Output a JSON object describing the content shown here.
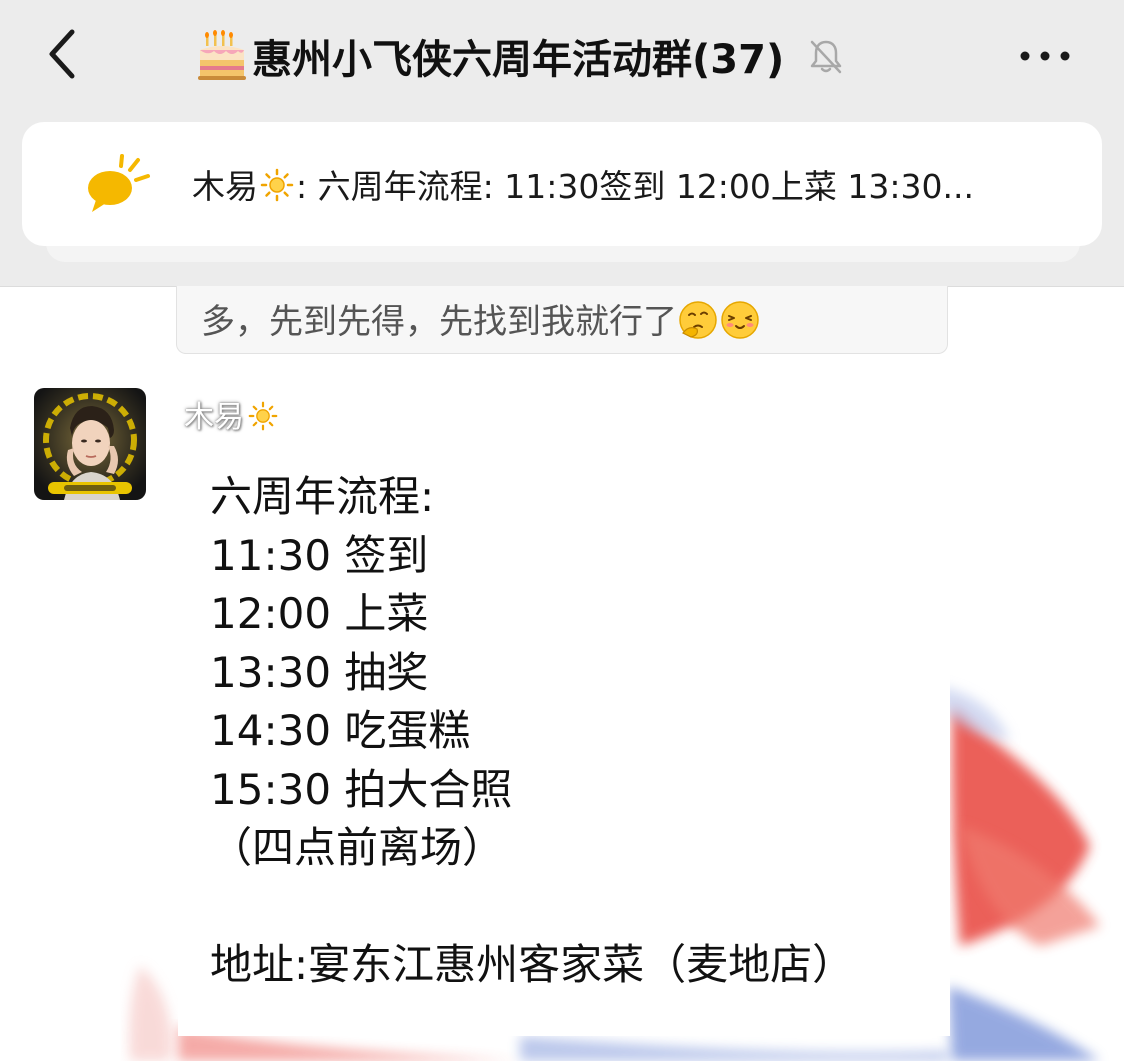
{
  "header": {
    "back_icon": "back-chevron-icon",
    "title_icon": "birthday-cake-emoji",
    "title": "惠州小飞侠六周年活动群(37)",
    "mute_icon": "muted-bell-icon",
    "more_icon": "more-dots-icon"
  },
  "pinned": {
    "icon": "speech-bubble-announcement-icon",
    "sender": "木易",
    "separator": ":",
    "preview": " 六周年流程: 11:30签到 12:00上菜 13:30..."
  },
  "previous_message": {
    "text": "多，先到先得，先找到我就行了",
    "emojis": [
      "thinking-face-emoji",
      "smiling-face-emoji"
    ]
  },
  "message": {
    "sender": "木易",
    "sender_icon": "sun-emoji",
    "avatar_icon": "user-avatar",
    "lines": [
      "六周年流程:",
      "11:30 签到",
      "12:00 上菜",
      "13:30 抽奖",
      "14:30 吃蛋糕",
      "15:30 拍大合照",
      "（四点前离场）",
      "",
      "地址:宴东江惠州客家菜（麦地店）"
    ]
  },
  "colors": {
    "navbar_bg": "#ececec",
    "pinned_icon": "#f5b800",
    "chat_bg": "#ffffff",
    "wallpaper_red": "#e8453c",
    "wallpaper_blue": "#3f63c8"
  }
}
